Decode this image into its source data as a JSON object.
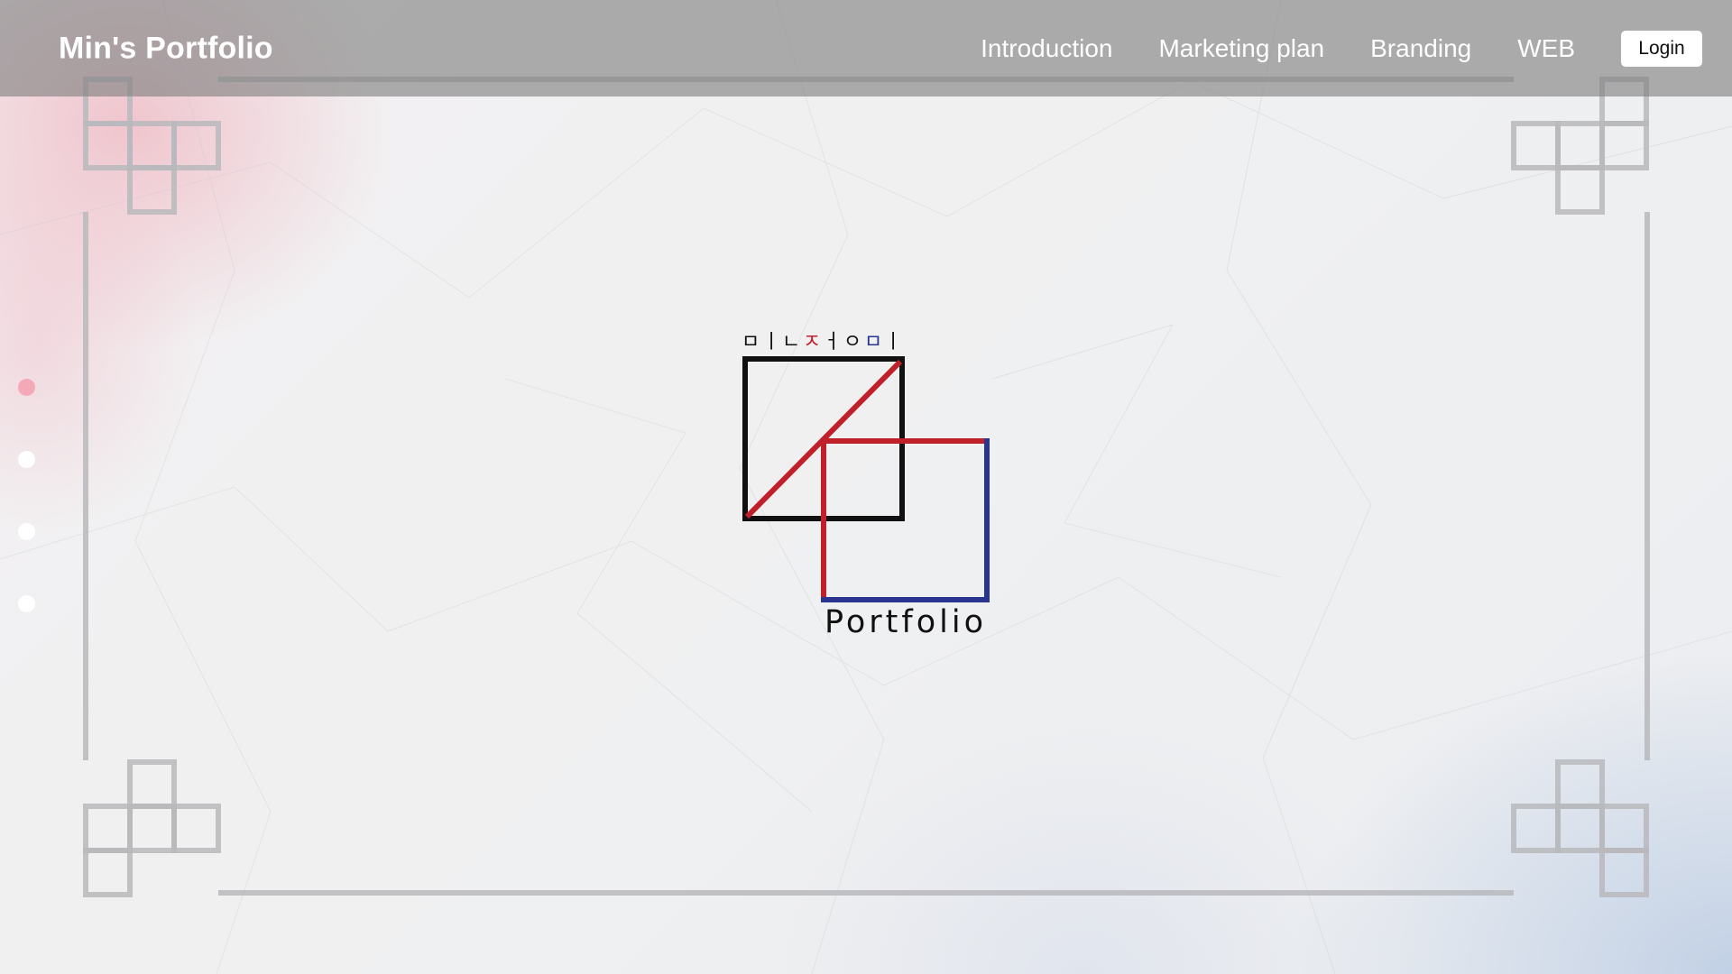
{
  "header": {
    "brand": "Min's Portfolio",
    "nav": [
      "Introduction",
      "Marketing plan",
      "Branding",
      "WEB"
    ],
    "login_label": "Login"
  },
  "section_dots": {
    "count": 4,
    "active_index": 0,
    "active_color": "#f4a9b8",
    "inactive_color": "#ffffff"
  },
  "logo": {
    "hangul_jamo": [
      "ㅁ",
      "ㅣ",
      "ㄴ",
      "ㅈ",
      "ㅓ",
      "ㅇ",
      "ㅁ",
      "ㅣ"
    ],
    "jamo_colors": [
      "#111111",
      "#111111",
      "#111111",
      "#c0202a",
      "#111111",
      "#111111",
      "#2a3590",
      "#111111"
    ],
    "wordmark": "Portfolio",
    "colors": {
      "black": "#111111",
      "red": "#c0202a",
      "blue": "#2a3590"
    }
  },
  "theme": {
    "topbar_color": "rgba(128,128,128,0.62)",
    "frame_color": "#b8b8bc",
    "pink_accent": "#eea0af",
    "blue_accent": "#a0b9dc"
  }
}
